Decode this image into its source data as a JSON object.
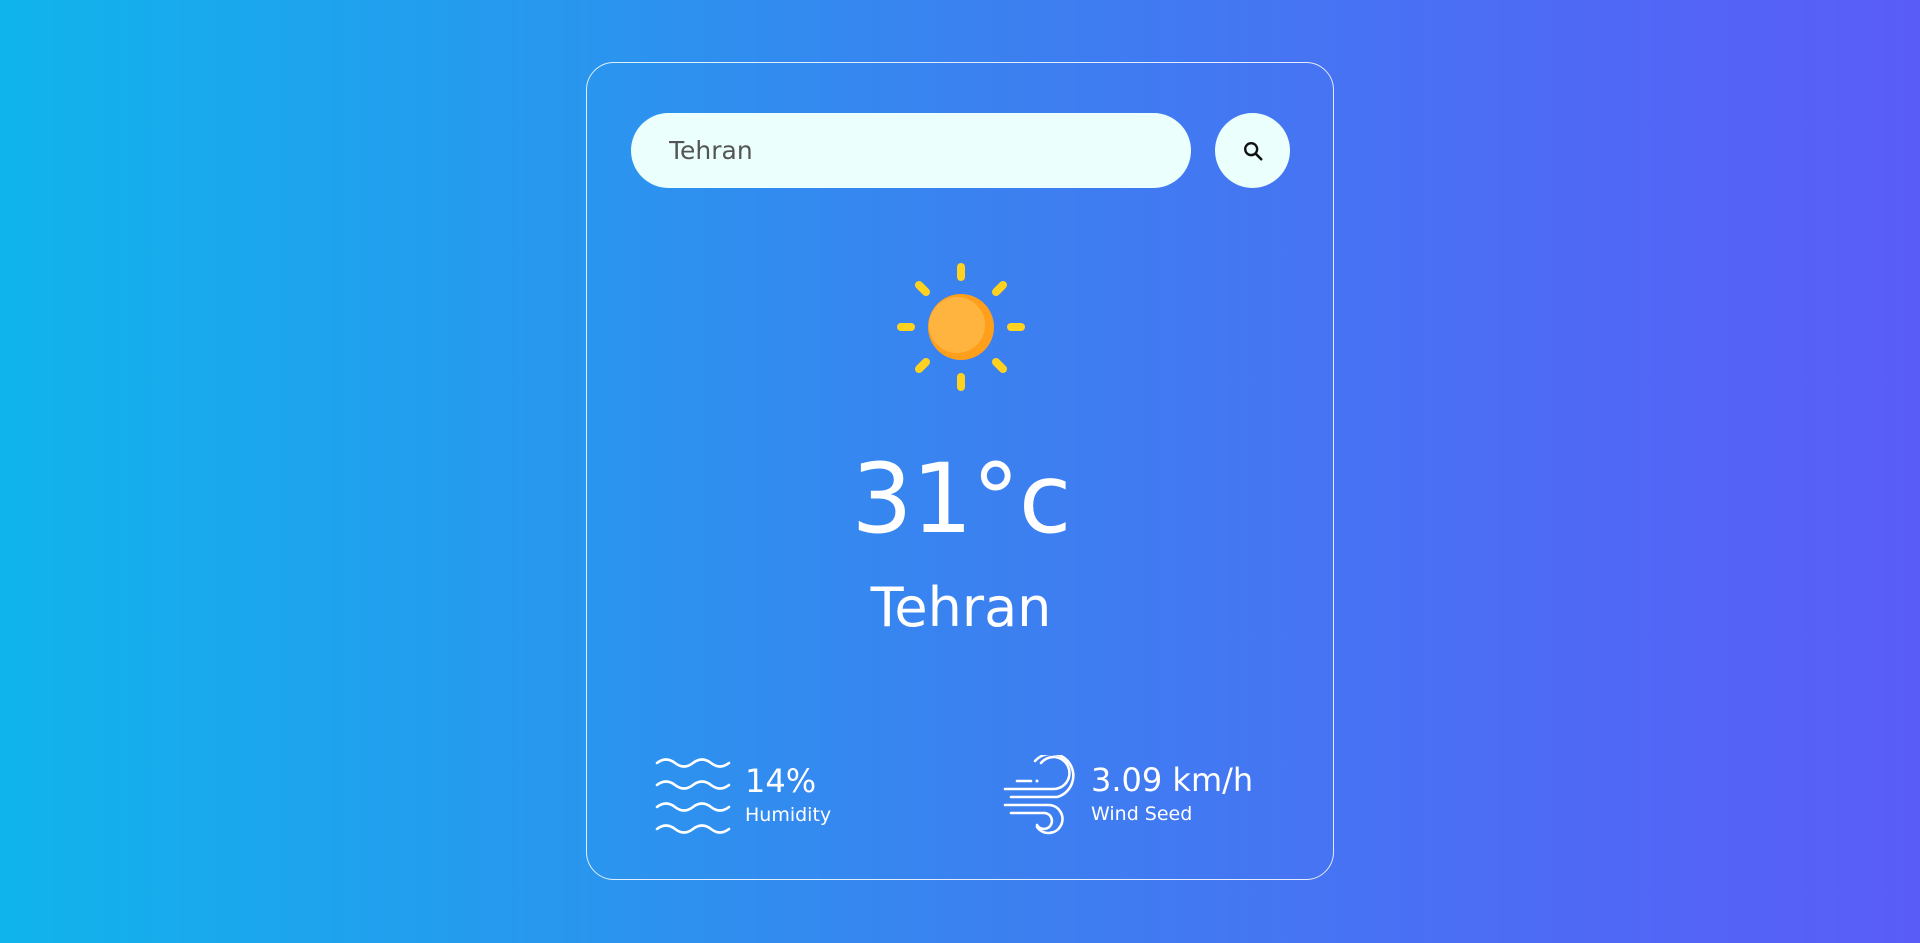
{
  "search": {
    "value": "Tehran",
    "placeholder": "Tehran",
    "button_icon": "search-icon"
  },
  "weather": {
    "icon": "sun-icon",
    "temperature": "31°c",
    "city": "Tehran"
  },
  "stats": {
    "humidity": {
      "icon": "humidity-waves-icon",
      "value": "14%",
      "label": "Humidity"
    },
    "wind": {
      "icon": "wind-icon",
      "value": "3.09 km/h",
      "label": "Wind Seed"
    }
  },
  "colors": {
    "background_start": "#10b4ec",
    "background_end": "#5a5cf8",
    "input_background": "#ebfffc",
    "sun_rays": "#ffd21f",
    "sun_body": "#ffae2b"
  }
}
